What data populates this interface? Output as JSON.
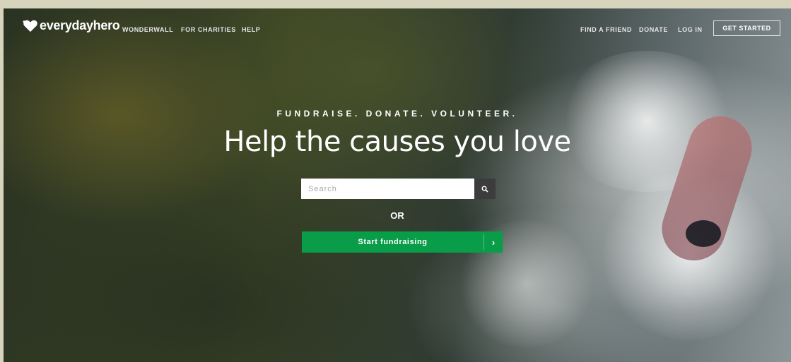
{
  "brand": {
    "name": "everydayhero"
  },
  "nav": {
    "left_links": [
      "WONDERWALL",
      "FOR CHARITIES",
      "HELP"
    ],
    "right_links": [
      "FIND A FRIEND",
      "DONATE",
      "LOG IN"
    ],
    "cta": "GET STARTED"
  },
  "hero": {
    "tagline": "FUNDRAISE. DONATE. VOLUNTEER.",
    "headline": "Help the causes you love",
    "search_placeholder": "Search",
    "or_text": "OR",
    "fundraise_button": "Start fundraising",
    "fundraise_arrow": "›"
  },
  "colors": {
    "accent_green": "#0a9d49",
    "search_button": "#3c3c3c",
    "page_frame": "#d6d4bd"
  },
  "icons": {
    "search": "search-icon",
    "chevron": "chevron-right-icon",
    "logo": "heart-logo-icon"
  }
}
